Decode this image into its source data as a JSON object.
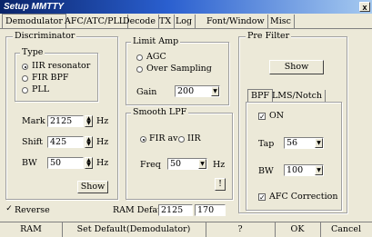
{
  "window": {
    "title": "Setup MMTTY",
    "close_label": "x"
  },
  "tabs": [
    {
      "label": "Demodulator",
      "selected": true
    },
    {
      "label": "AFC/ATC/PLL",
      "selected": false
    },
    {
      "label": "Decode",
      "selected": false
    },
    {
      "label": "TX",
      "selected": false
    },
    {
      "label": "Log",
      "selected": false
    },
    {
      "label": "Font/Window",
      "selected": false
    },
    {
      "label": "Misc",
      "selected": false
    }
  ],
  "discriminator": {
    "title": "Discriminator",
    "type_label": "Type",
    "options": [
      {
        "label": "IIR resonator",
        "checked": true
      },
      {
        "label": "FIR BPF",
        "checked": false
      },
      {
        "label": "PLL",
        "checked": false
      }
    ],
    "mark": {
      "label": "Mark",
      "value": "2125",
      "unit": "Hz"
    },
    "shift": {
      "label": "Shift",
      "value": "425",
      "unit": "Hz"
    },
    "bw": {
      "label": "BW",
      "value": "50",
      "unit": "Hz"
    },
    "show_label": "Show"
  },
  "limit_amp": {
    "title": "Limit Amp",
    "options": [
      {
        "label": "AGC",
        "checked": false
      },
      {
        "label": "Over Sampling",
        "checked": false
      }
    ],
    "gain": {
      "label": "Gain",
      "value": "200"
    }
  },
  "smooth_lpf": {
    "title": "Smooth LPF",
    "options": [
      {
        "label": "FIR av",
        "checked": true
      },
      {
        "label": "IIR",
        "checked": false
      }
    ],
    "freq": {
      "label": "Freq",
      "value": "50",
      "unit": "Hz"
    },
    "more_label": "!"
  },
  "pre_filter": {
    "title": "Pre Filter",
    "show_label": "Show",
    "inner_tabs": [
      "BPF",
      "LMS/Notch"
    ],
    "on_label": "ON",
    "on_checked": true,
    "tap": {
      "label": "Tap",
      "value": "56"
    },
    "bw": {
      "label": "BW",
      "value": "100"
    },
    "afc_label": "AFC Correction",
    "afc_checked": true
  },
  "reverse": {
    "label": "Reverse",
    "checked": true
  },
  "ram_default": {
    "label": "RAM Default",
    "value1": "2125",
    "value2": "170"
  },
  "bottom": {
    "ram_label": "RAM",
    "set_default_label": "Set Default(Demodulator)",
    "help_label": "?",
    "ok_label": "OK",
    "cancel_label": "Cancel"
  }
}
